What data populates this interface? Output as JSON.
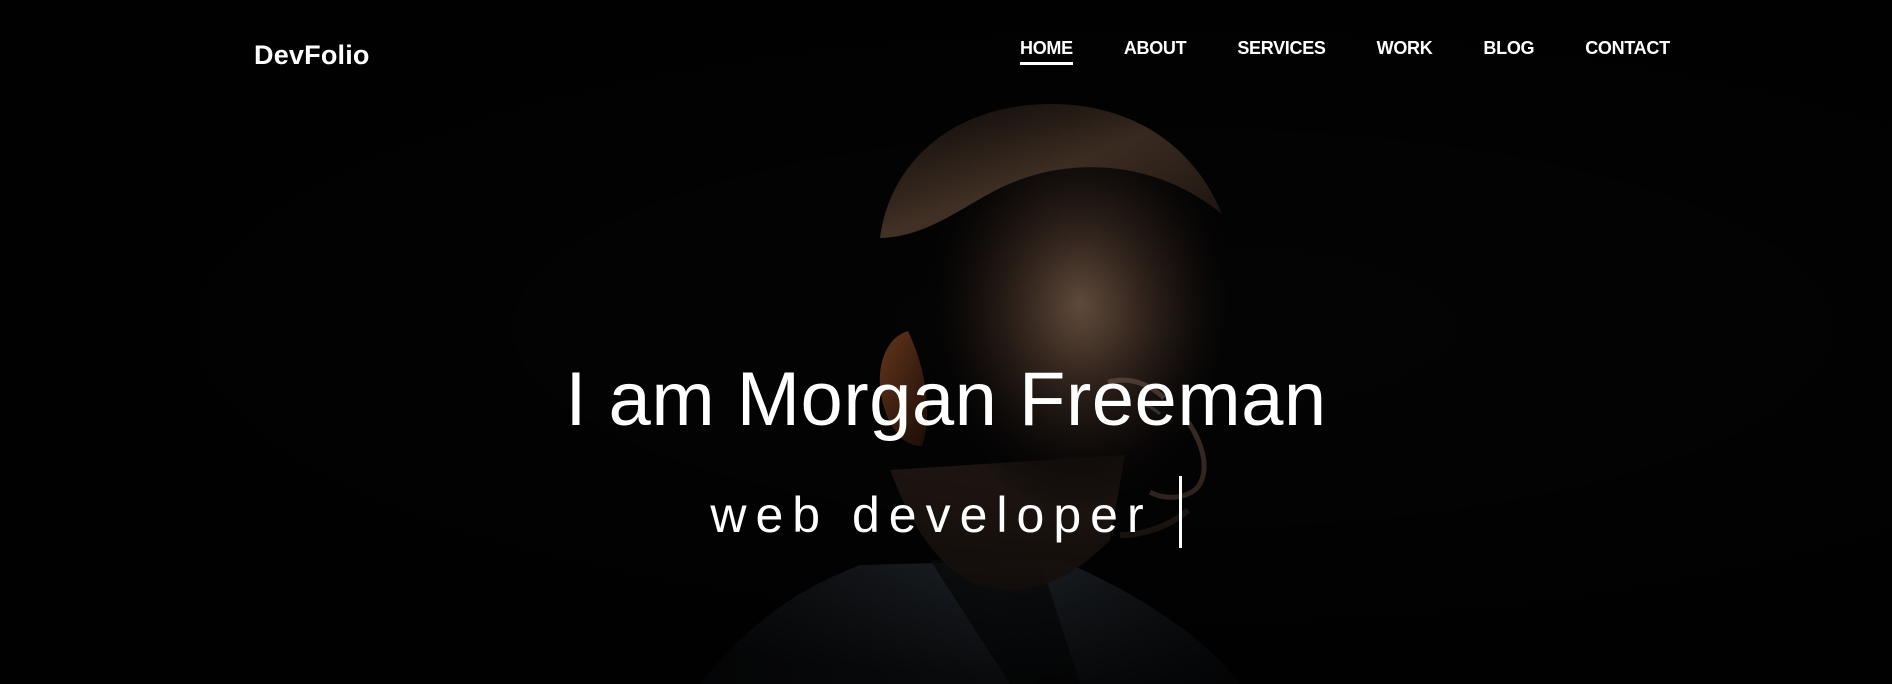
{
  "brand": {
    "name": "DevFolio"
  },
  "nav": {
    "items": [
      {
        "label": "HOME"
      },
      {
        "label": "ABOUT"
      },
      {
        "label": "SERVICES"
      },
      {
        "label": "WORK"
      },
      {
        "label": "BLOG"
      },
      {
        "label": "CONTACT"
      }
    ]
  },
  "hero": {
    "title": "I am Morgan Freeman",
    "subtitle": "web developer"
  },
  "colors": {
    "background": "#050505",
    "text": "#ffffff"
  }
}
